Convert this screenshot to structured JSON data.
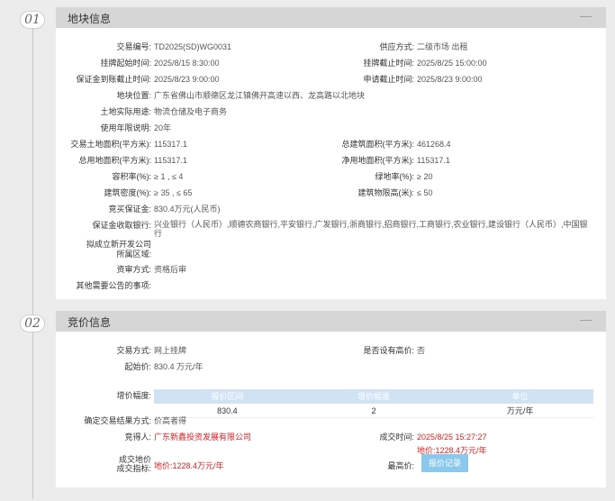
{
  "section1": {
    "num": "01",
    "title": "地块信息",
    "collapse": "—",
    "left_fields": [
      {
        "label": "交易编号:",
        "value": "TD2025(SD)WG0031"
      },
      {
        "label": "挂牌起始时间:",
        "value": "2025/8/15 8:30:00"
      },
      {
        "label": "保证金到账截止时间:",
        "value": "2025/8/23 9:00:00"
      },
      {
        "label": "地块位置:",
        "value": "广东省佛山市顺德区龙江镇佛开高速以西、龙高路以北地块"
      },
      {
        "label": "土地实际用途:",
        "value": "物流仓储及电子商务"
      },
      {
        "label": "使用年限说明:",
        "value": "20年"
      },
      {
        "label": "交易土地面积(平方米):",
        "value": "115317.1"
      },
      {
        "label": "总用地面积(平方米):",
        "value": "115317.1"
      },
      {
        "label": "容积率(%):",
        "value": "≥ 1 , ≤ 4"
      },
      {
        "label": "建筑密度(%):",
        "value": "≥ 35 , ≤ 65"
      },
      {
        "label": "竞买保证金:",
        "value": "830.4万元(人民币)"
      },
      {
        "label": "保证金收取银行:",
        "value": "兴业银行（人民币）,顺德农商银行,平安银行,广发银行,浙商银行,招商银行,工商银行,农业银行,建设银行（人民币）,中国银行"
      },
      {
        "label": "拟成立新开发公司",
        "value": ""
      },
      {
        "label": "所属区域:",
        "value": ""
      },
      {
        "label": "资审方式:",
        "value": "资格后审"
      },
      {
        "label": "其他需要公告的事项:",
        "value": ""
      }
    ],
    "right_fields": [
      {
        "label": "供应方式:",
        "value": "二级市场 出租"
      },
      {
        "label": "挂牌截止时间:",
        "value": "2025/8/25 15:00:00"
      },
      {
        "label": "申请截止时间:",
        "value": "2025/8/23 9:00:00"
      },
      {
        "label": "总建筑面积(平方米):",
        "value": "461268.4"
      },
      {
        "label": "净用地面积(平方米):",
        "value": "115317.1"
      },
      {
        "label": "绿地率(%):",
        "value": "≥ 20"
      },
      {
        "label": "建筑物限高(米):",
        "value": "≤ 50"
      }
    ]
  },
  "section2": {
    "num": "02",
    "title": "竞价信息",
    "collapse": "—",
    "trade_mode_label": "交易方式:",
    "trade_mode": "网上挂牌",
    "ceiling_label": "是否设有高价:",
    "ceiling": "否",
    "start_price_label": "起始价:",
    "start_price": "830.4 万元/年",
    "increment_label": "增价幅度:",
    "table_headers": [
      "报价区间",
      "增价幅度",
      "单位"
    ],
    "table_row": [
      "830.4",
      "2",
      "万元/年"
    ],
    "result_mode_label": "确定交易结果方式:",
    "result_mode": "价高者得",
    "winner_label": "竞得人:",
    "winner": "广东新鑫投资发展有限公司",
    "deal_time_label": "成交时间:",
    "deal_time": "2025/8/25 15:27:27",
    "deal_price_label_1": "成交地价",
    "deal_price_label_2": "成交指标:",
    "deal_price": "地价:1228.4万元/年",
    "max_price_label": "最高价:",
    "max_price": "地价:1228.4万元/年",
    "record_button": "报价记录"
  }
}
